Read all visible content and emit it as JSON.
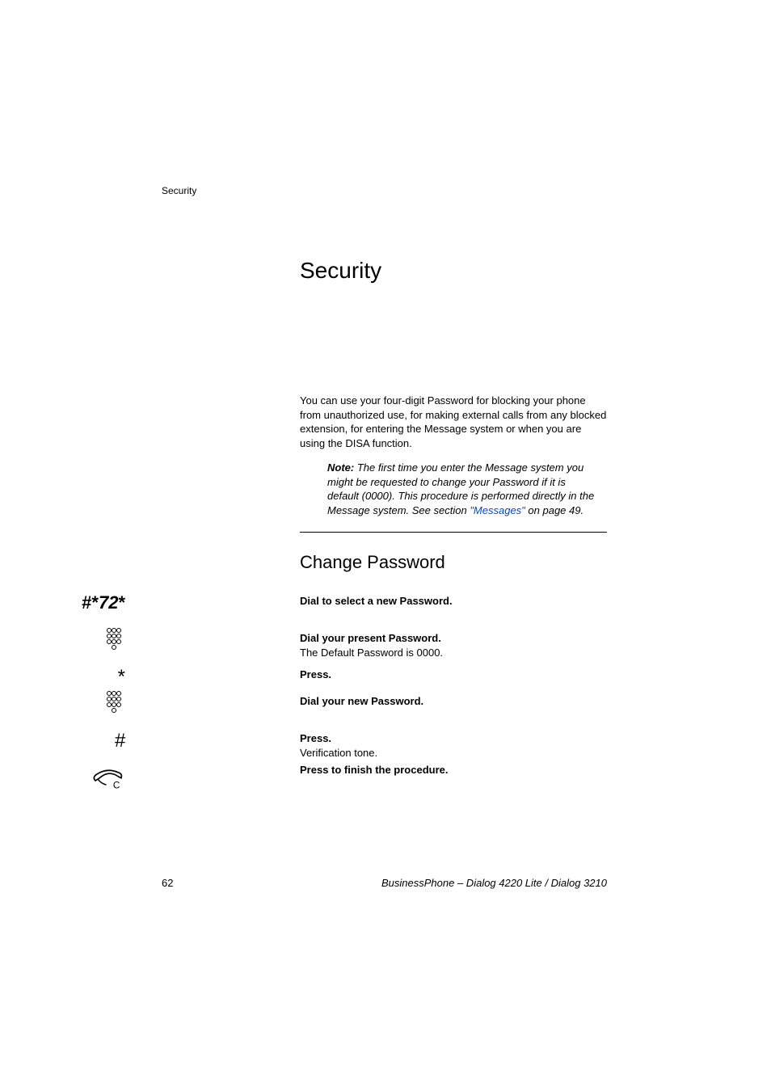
{
  "header": {
    "running_head": "Security"
  },
  "title": "Security",
  "intro": "You can use your four-digit Password for blocking your phone from unauthorized use, for making external calls from any blocked extension, for entering the Message system or when you are using the DISA function.",
  "note": {
    "label": "Note:",
    "pre": "The first time you enter the Message system you might be requested to change your Password if it is default (0000). This procedure is performed directly in the Message system. See section ",
    "link": "\"Messages\"",
    "post": " on page 49."
  },
  "subheading": "Change Password",
  "steps": {
    "s1": {
      "code_hash1": "#",
      "code_star1": "*",
      "code_digits": "72",
      "code_star2": "*",
      "text": "Dial to select a new Password."
    },
    "s2": {
      "text_bold": "Dial your present Password.",
      "text_plain": "The Default Password is 0000."
    },
    "s3": {
      "symbol": "*",
      "text": "Press."
    },
    "s4": {
      "text": "Dial your new Password."
    },
    "s5": {
      "symbol": "#",
      "text_bold": "Press.",
      "text_plain": "Verification tone."
    },
    "s6": {
      "letter": "C",
      "text": "Press to finish the procedure."
    }
  },
  "footer": {
    "page": "62",
    "doc": "BusinessPhone – Dialog 4220 Lite / Dialog 3210"
  }
}
